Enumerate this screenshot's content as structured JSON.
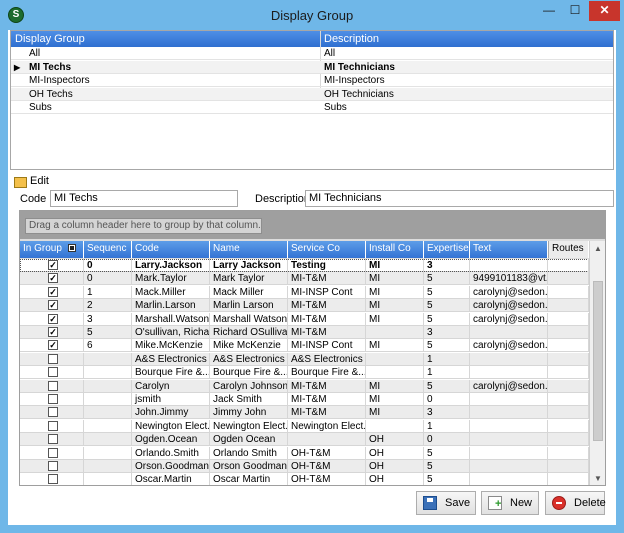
{
  "window": {
    "title": "Display Group",
    "icon_letter": "S",
    "minimize_glyph": "—",
    "maximize_glyph": "☐",
    "close_glyph": "✕"
  },
  "top_grid": {
    "columns": [
      "Display Group",
      "Description"
    ],
    "rows": [
      {
        "group": "All",
        "description": "All"
      },
      {
        "group": "MI Techs",
        "description": "MI Technicians"
      },
      {
        "group": "MI-Inspectors",
        "description": "MI-Inspectors"
      },
      {
        "group": "OH Techs",
        "description": "OH Technicians"
      },
      {
        "group": "Subs",
        "description": "Subs"
      }
    ],
    "selected_index": 1
  },
  "edit": {
    "label": "Edit",
    "code_label": "Code",
    "code_value": "MI Techs",
    "description_label": "Description",
    "description_value": "MI Technicians"
  },
  "grid": {
    "group_hint": "Drag a column header here to group by that column.",
    "columns": [
      "In Group",
      "Sequenc",
      "Code",
      "Name",
      "Service Co",
      "Install Co",
      "Expertise",
      "Text",
      "Routes"
    ],
    "rows": [
      {
        "in_group": true,
        "seq": "0",
        "code": "Larry.Jackson",
        "name": "Larry Jackson",
        "service": "Testing",
        "install": "MI",
        "expertise": "3",
        "text": ""
      },
      {
        "in_group": true,
        "seq": "0",
        "code": "Mark.Taylor",
        "name": "Mark Taylor",
        "service": "MI-T&M",
        "install": "MI",
        "expertise": "5",
        "text": "9499101183@vt..."
      },
      {
        "in_group": true,
        "seq": "1",
        "code": "Mack.Miller",
        "name": "Mack Miller",
        "service": "MI-INSP Cont",
        "install": "MI",
        "expertise": "5",
        "text": "carolynj@sedon..."
      },
      {
        "in_group": true,
        "seq": "2",
        "code": "Marlin.Larson",
        "name": "Marlin Larson",
        "service": "MI-T&M",
        "install": "MI",
        "expertise": "5",
        "text": "carolynj@sedon..."
      },
      {
        "in_group": true,
        "seq": "3",
        "code": "Marshall.Watson",
        "name": "Marshall Watson",
        "service": "MI-T&M",
        "install": "MI",
        "expertise": "5",
        "text": "carolynj@sedon..."
      },
      {
        "in_group": true,
        "seq": "5",
        "code": "O'sullivan, Richa...",
        "name": "Richard OSulliva...",
        "service": "MI-T&M",
        "install": "",
        "expertise": "3",
        "text": ""
      },
      {
        "in_group": true,
        "seq": "6",
        "code": "Mike.McKenzie",
        "name": "Mike McKenzie",
        "service": "MI-INSP Cont",
        "install": "MI",
        "expertise": "5",
        "text": "carolynj@sedon..."
      },
      {
        "in_group": false,
        "seq": "",
        "code": "A&S Electronics",
        "name": "A&S Electronics",
        "service": "A&S Electronics",
        "install": "",
        "expertise": "1",
        "text": ""
      },
      {
        "in_group": false,
        "seq": "",
        "code": "Bourque Fire &...",
        "name": "Bourque Fire &...",
        "service": "Bourque Fire &...",
        "install": "",
        "expertise": "1",
        "text": ""
      },
      {
        "in_group": false,
        "seq": "",
        "code": "Carolyn",
        "name": "Carolyn Johnson",
        "service": "MI-T&M",
        "install": "MI",
        "expertise": "5",
        "text": "carolynj@sedon..."
      },
      {
        "in_group": false,
        "seq": "",
        "code": "jsmith",
        "name": "Jack Smith",
        "service": "MI-T&M",
        "install": "MI",
        "expertise": "0",
        "text": ""
      },
      {
        "in_group": false,
        "seq": "",
        "code": "John.Jimmy",
        "name": "Jimmy John",
        "service": "MI-T&M",
        "install": "MI",
        "expertise": "3",
        "text": ""
      },
      {
        "in_group": false,
        "seq": "",
        "code": "Newington Elect...",
        "name": "Newington Elect...",
        "service": "Newington Elect...",
        "install": "",
        "expertise": "1",
        "text": ""
      },
      {
        "in_group": false,
        "seq": "",
        "code": "Ogden.Ocean",
        "name": "Ogden Ocean",
        "service": "",
        "install": "OH",
        "expertise": "0",
        "text": ""
      },
      {
        "in_group": false,
        "seq": "",
        "code": "Orlando.Smith",
        "name": "Orlando Smith",
        "service": "OH-T&M",
        "install": "OH",
        "expertise": "5",
        "text": ""
      },
      {
        "in_group": false,
        "seq": "",
        "code": "Orson.Goodman",
        "name": "Orson Goodman",
        "service": "OH-T&M",
        "install": "OH",
        "expertise": "5",
        "text": ""
      },
      {
        "in_group": false,
        "seq": "",
        "code": "Oscar.Martin",
        "name": "Oscar Martin",
        "service": "OH-T&M",
        "install": "OH",
        "expertise": "5",
        "text": ""
      }
    ]
  },
  "buttons": {
    "save": "Save",
    "new": "New",
    "delete": "Delete"
  }
}
